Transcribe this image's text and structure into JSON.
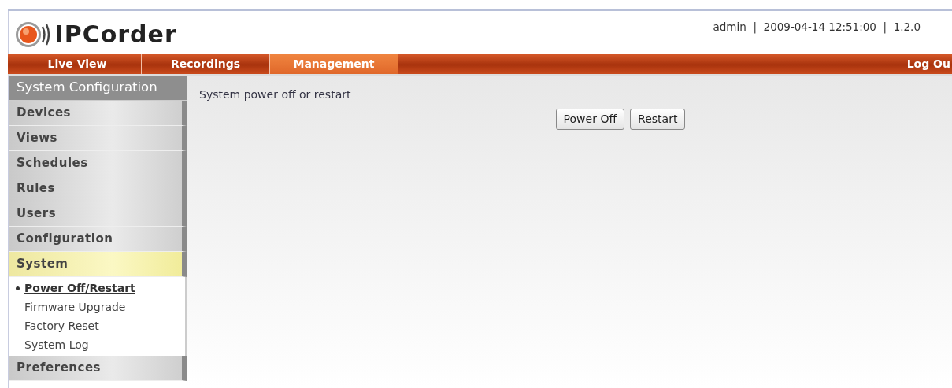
{
  "header": {
    "logo_text": "IPCorder",
    "info": "admin  |  2009-04-14 12:51:00  |  1.2.0"
  },
  "nav": {
    "tabs": [
      {
        "label": "Live View",
        "selected": false
      },
      {
        "label": "Recordings",
        "selected": false
      },
      {
        "label": "Management",
        "selected": true
      }
    ],
    "logout": "Log Ou"
  },
  "sidebar": {
    "title": "System Configuration",
    "items": [
      {
        "label": "Devices",
        "expanded": false
      },
      {
        "label": "Views",
        "expanded": false
      },
      {
        "label": "Schedules",
        "expanded": false
      },
      {
        "label": "Rules",
        "expanded": false
      },
      {
        "label": "Users",
        "expanded": false
      },
      {
        "label": "Configuration",
        "expanded": false
      },
      {
        "label": "System",
        "expanded": true,
        "children": [
          {
            "label": "Power Off/Restart",
            "selected": true
          },
          {
            "label": "Firmware Upgrade",
            "selected": false
          },
          {
            "label": "Factory Reset",
            "selected": false
          },
          {
            "label": "System Log",
            "selected": false
          }
        ]
      },
      {
        "label": "Preferences",
        "expanded": false
      }
    ]
  },
  "content": {
    "description": "System power off or restart",
    "buttons": [
      "Power Off",
      "Restart"
    ]
  }
}
